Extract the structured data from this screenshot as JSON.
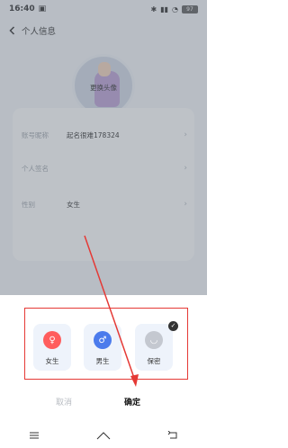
{
  "status_bar": {
    "time": "16:40",
    "battery": "97"
  },
  "header": {
    "title": "个人信息"
  },
  "avatar": {
    "label": "更换头像"
  },
  "info": {
    "rows": [
      {
        "label": "账号昵称",
        "value": "起名很难178324"
      },
      {
        "label": "个人签名",
        "value": ""
      },
      {
        "label": "性别",
        "value": "女生"
      }
    ]
  },
  "sheet": {
    "options": [
      {
        "label": "女生",
        "icon": "female-icon",
        "color": "#ff5d5d"
      },
      {
        "label": "男生",
        "icon": "male-icon",
        "color": "#4b7bec"
      },
      {
        "label": "保密",
        "icon": "secret-icon",
        "color": "#c4c8d0"
      }
    ],
    "cancel": "取消",
    "confirm": "确定"
  },
  "colors": {
    "accent": "#e53935"
  }
}
